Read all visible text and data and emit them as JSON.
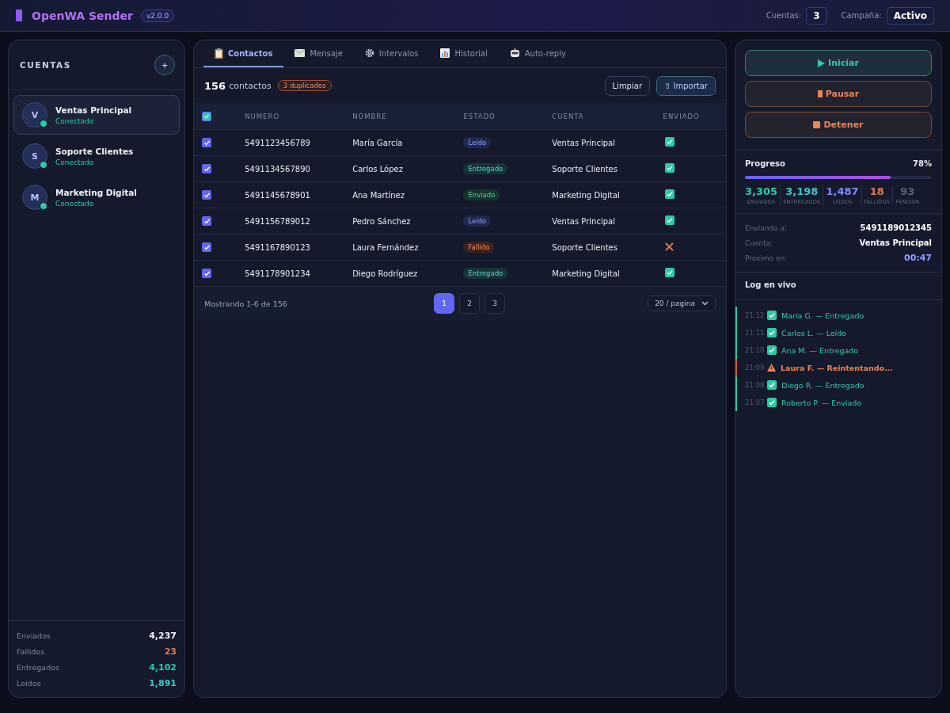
{
  "header": {
    "title": "OpenWA Sender",
    "version": "v2.0.0",
    "stats": [
      {
        "label": "Cuentas:",
        "value": "3"
      },
      {
        "label": "Campaña:",
        "value": "Activo"
      }
    ]
  },
  "accounts": {
    "title": "CUENTAS",
    "add": "+",
    "items": [
      {
        "initial": "V",
        "name": "Ventas Principal",
        "status": "Conectado",
        "online": true,
        "selected": true
      },
      {
        "initial": "S",
        "name": "Soporte Clientes",
        "status": "Conectado",
        "online": true,
        "selected": false
      },
      {
        "initial": "M",
        "name": "Marketing Digital",
        "status": "Conectado",
        "online": true,
        "selected": false
      }
    ],
    "totals": [
      {
        "label": "Enviados",
        "value": "4,237",
        "color": "#f1f3f8"
      },
      {
        "label": "Fallidos",
        "value": "23",
        "color": "#e07a52"
      },
      {
        "label": "Entregados",
        "value": "4,102",
        "color": "#2fc9a5"
      },
      {
        "label": "Leídos",
        "value": "1,891",
        "color": "#3ec6c6"
      }
    ]
  },
  "tabs": [
    {
      "label": "Contactos",
      "selected": true
    },
    {
      "label": "Mensaje",
      "selected": false
    },
    {
      "label": "Intervalos",
      "selected": false
    },
    {
      "label": "Historial",
      "selected": false
    },
    {
      "label": "Auto-reply",
      "selected": false
    }
  ],
  "toolbar": {
    "count": "156",
    "count_label": "contactos",
    "duplicates": "3 duplicados",
    "buttons": [
      {
        "label": "Limpiar",
        "primary": false
      },
      {
        "label": "⇧ Importar",
        "primary": true
      }
    ]
  },
  "table": {
    "all_checked": true,
    "columns": [
      "NUMERO",
      "NOMBRE",
      "ESTADO",
      "CUENTA",
      "ENVIADO"
    ],
    "rows": [
      {
        "checked": true,
        "number": "5491123456789",
        "name": "María García",
        "status": "Leído",
        "kind": "read",
        "account": "Ventas Principal",
        "sent": true
      },
      {
        "checked": true,
        "number": "5491134567890",
        "name": "Carlos López",
        "status": "Entregado",
        "kind": "delivered",
        "account": "Soporte Clientes",
        "sent": true
      },
      {
        "checked": true,
        "number": "5491145678901",
        "name": "Ana Martínez",
        "status": "Enviado",
        "kind": "sent",
        "account": "Marketing Digital",
        "sent": true
      },
      {
        "checked": true,
        "number": "5491156789012",
        "name": "Pedro Sánchez",
        "status": "Leído",
        "kind": "read",
        "account": "Ventas Principal",
        "sent": true
      },
      {
        "checked": true,
        "number": "5491167890123",
        "name": "Laura Fernández",
        "status": "Fallido",
        "kind": "failed",
        "account": "Soporte Clientes",
        "sent": false
      },
      {
        "checked": true,
        "number": "5491178901234",
        "name": "Diego Rodríguez",
        "status": "Entregado",
        "kind": "delivered",
        "account": "Marketing Digital",
        "sent": true
      }
    ]
  },
  "pagination": {
    "summary": "Mostrando 1-6 de 156",
    "pages": [
      {
        "label": "1",
        "selected": true
      },
      {
        "label": "2",
        "selected": false
      },
      {
        "label": "3",
        "selected": false
      }
    ],
    "per_page": "20 / pagina"
  },
  "controls": [
    {
      "label": "Iniciar",
      "kind": "start"
    },
    {
      "label": "Pausar",
      "kind": "pause"
    },
    {
      "label": "Detener",
      "kind": "stop"
    }
  ],
  "progress": {
    "label": "Progreso",
    "percent": "78%",
    "level": 0.78,
    "stats": [
      {
        "value": "3,305",
        "label": "ENVIADOS",
        "color": "#2fc9a5"
      },
      {
        "value": "3,198",
        "label": "ENTREGADOS",
        "color": "#3ec6c6"
      },
      {
        "value": "1,487",
        "label": "LEIDOS",
        "color": "#7f8cf5"
      },
      {
        "value": "18",
        "label": "FALLIDOS",
        "color": "#e07a52"
      },
      {
        "value": "93",
        "label": "PENDIEN",
        "color": "#5b6478"
      }
    ]
  },
  "current": [
    {
      "label": "Enviando a:",
      "value": "5491189012345",
      "kind": "plain"
    },
    {
      "label": "Cuenta:",
      "value": "Ventas Principal",
      "kind": "plain"
    },
    {
      "label": "Proximo en:",
      "value": "00:47",
      "kind": "timer"
    }
  ],
  "log": {
    "title": "Log en vivo",
    "entries": [
      {
        "time": "21:12",
        "text": "María G. — Entregado",
        "kind": "ok"
      },
      {
        "time": "21:11",
        "text": "Carlos L. — Leído",
        "kind": "ok"
      },
      {
        "time": "21:10",
        "text": "Ana M. — Entregado",
        "kind": "ok"
      },
      {
        "time": "21:09",
        "text": "Laura F. — Reintentando...",
        "kind": "warn"
      },
      {
        "time": "21:08",
        "text": "Diego R. — Entregado",
        "kind": "ok"
      },
      {
        "time": "21:07",
        "text": "Roberto P. — Enviado",
        "kind": "ok"
      }
    ]
  }
}
